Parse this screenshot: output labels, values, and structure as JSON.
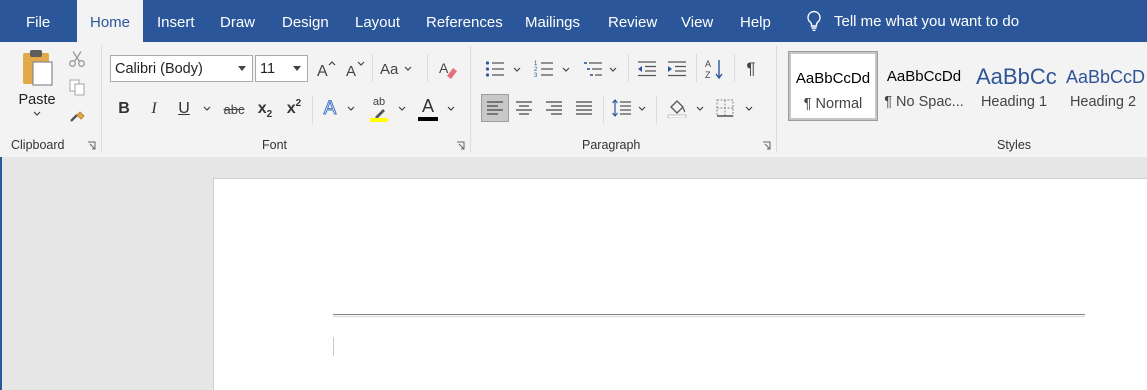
{
  "tabs": [
    {
      "label": "File",
      "active": false
    },
    {
      "label": "Home",
      "active": true
    },
    {
      "label": "Insert",
      "active": false
    },
    {
      "label": "Draw",
      "active": false
    },
    {
      "label": "Design",
      "active": false
    },
    {
      "label": "Layout",
      "active": false
    },
    {
      "label": "References",
      "active": false
    },
    {
      "label": "Mailings",
      "active": false
    },
    {
      "label": "Review",
      "active": false
    },
    {
      "label": "View",
      "active": false
    },
    {
      "label": "Help",
      "active": false
    }
  ],
  "tell_me": {
    "label": "Tell me what you want to do",
    "icon": "lightbulb-icon"
  },
  "clipboard": {
    "paste_label": "Paste",
    "group_label": "Clipboard"
  },
  "font": {
    "group_label": "Font",
    "font_name": "Calibri (Body)",
    "font_size": "11",
    "change_case_label": "Aa",
    "bold": "B",
    "italic": "I",
    "underline": "U",
    "strikethrough": "abc",
    "subscript": "x",
    "subscript_sub": "2",
    "superscript": "x",
    "superscript_sup": "2",
    "text_effects": "A",
    "highlight_label": "ab",
    "highlight_color": "#ffff00",
    "font_color_label": "A",
    "font_color": "#000000"
  },
  "paragraph": {
    "group_label": "Paragraph"
  },
  "styles": {
    "group_label": "Styles",
    "items": [
      {
        "sample": "AaBbCcDd",
        "name": "¶ Normal",
        "selected": true
      },
      {
        "sample": "AaBbCcDd",
        "name": "¶ No Spac...",
        "selected": false
      },
      {
        "sample": "AaBbCc",
        "name": "Heading 1",
        "selected": false
      },
      {
        "sample": "AaBbCcD",
        "name": "Heading 2",
        "selected": false
      }
    ]
  },
  "colors": {
    "accent": "#2b579a",
    "ribbon_bg": "#f3f3f3",
    "doc_bg": "#e6e6e6",
    "heading_blue": "#2f5496"
  }
}
